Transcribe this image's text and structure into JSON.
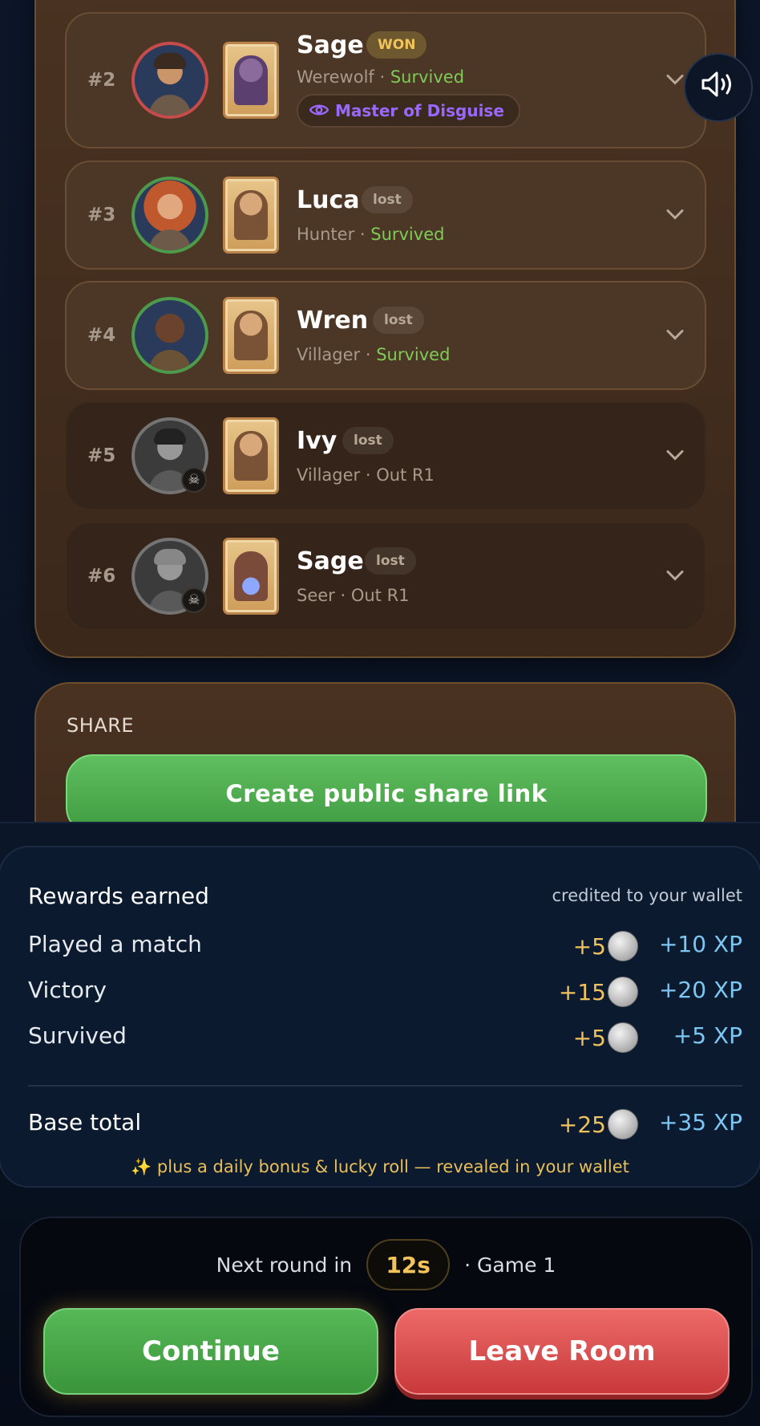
{
  "players": [
    {
      "rank": "#2",
      "name": "Sage",
      "badge": "WON",
      "role": "Werewolf",
      "sep": " · ",
      "status": "Survived",
      "honor": "Master of Disguise"
    },
    {
      "rank": "#3",
      "name": "Luca",
      "badge": "lost",
      "role": "Hunter",
      "sep": " · ",
      "status": "Survived"
    },
    {
      "rank": "#4",
      "name": "Wren",
      "badge": "lost",
      "role": "Villager",
      "sep": " · ",
      "status": "Survived"
    },
    {
      "rank": "#5",
      "name": "Ivy",
      "badge": "lost",
      "role": "Villager",
      "sep": " · ",
      "status": "Out R1"
    },
    {
      "rank": "#6",
      "name": "Sage",
      "badge": "lost",
      "role": "Seer",
      "sep": " · ",
      "status": "Out R1"
    }
  ],
  "share": {
    "title": "SHARE",
    "button": "Create public share link"
  },
  "rewards": {
    "title": "Rewards earned",
    "note": "credited to your wallet",
    "rows": [
      {
        "label": "Played a match",
        "coins": "+5",
        "xp": "+10 XP"
      },
      {
        "label": "Victory",
        "coins": "+15",
        "xp": "+20 XP"
      },
      {
        "label": "Survived",
        "coins": "+5",
        "xp": "+5 XP"
      }
    ],
    "total": {
      "label": "Base total",
      "coins": "+25",
      "xp": "+35 XP"
    },
    "footer": "✨  plus a daily bonus & lucky roll — revealed in your wallet"
  },
  "next_round": {
    "prefix": "Next round in",
    "timer": "12s",
    "suffix": "· Game 1"
  },
  "actions": {
    "continue": "Continue",
    "leave": "Leave Room"
  },
  "icons": {
    "speaker": "speaker-icon",
    "chevron": "chevron-down-icon",
    "skull": "skull-icon",
    "eye": "eye-icon",
    "coin": "coin-icon"
  },
  "colors": {
    "won": "#f1c35a",
    "survived": "#7ecb57",
    "honor": "#9b68ff",
    "coins": "#f0c15f",
    "xp": "#7cc6f2",
    "continue": "#4aa84a",
    "leave": "#d9474a"
  }
}
